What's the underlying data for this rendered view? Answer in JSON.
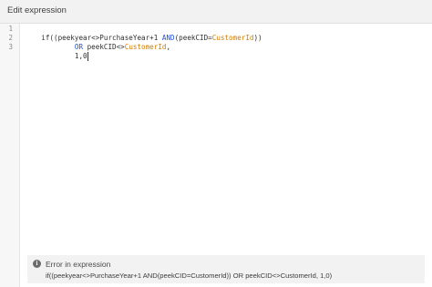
{
  "header": {
    "title": "Edit expression"
  },
  "editor": {
    "line_numbers": [
      "1",
      "2",
      "3"
    ],
    "lines": [
      [
        {
          "text": "if((peekyear<>PurchaseYear+1 ",
          "style": "default"
        },
        {
          "text": "AND",
          "style": "keyword"
        },
        {
          "text": "(peekCID=",
          "style": "default"
        },
        {
          "text": "CustomerId",
          "style": "field"
        },
        {
          "text": "))",
          "style": "default"
        }
      ],
      [
        {
          "text": "        ",
          "style": "default"
        },
        {
          "text": "OR",
          "style": "keyword"
        },
        {
          "text": " peekCID<>",
          "style": "default"
        },
        {
          "text": "CustomerId",
          "style": "field"
        },
        {
          "text": ",",
          "style": "default"
        }
      ],
      [
        {
          "text": "        1,0",
          "style": "default"
        }
      ]
    ]
  },
  "error": {
    "icon": "info-icon",
    "title": "Error in expression",
    "detail": "if((peekyear<>PurchaseYear+1 AND(peekCID=CustomerId)) OR peekCID<>CustomerId, 1,0)"
  },
  "colors": {
    "keyword": "#1e4fd8",
    "field": "#d27b00",
    "text": "#2f2f2f",
    "panel_bg": "#f2f2f2"
  }
}
